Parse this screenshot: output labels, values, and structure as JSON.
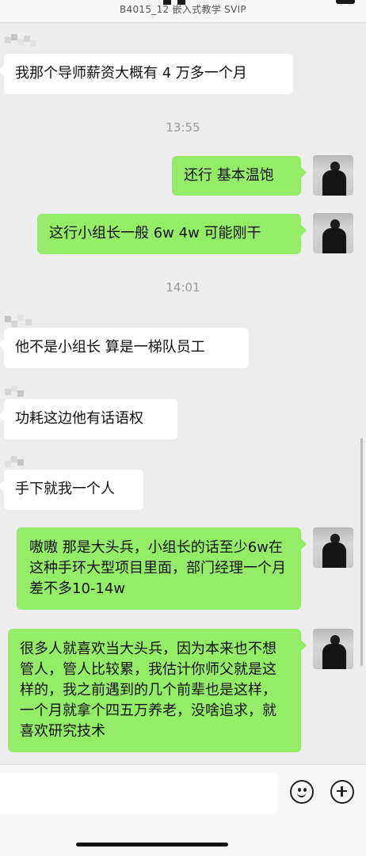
{
  "header": {
    "title": "B4015_12 嵌入式教学 SVIP"
  },
  "messages": [
    {
      "side": "in",
      "text": "我那个导师薪资大概有 4 万多一个月"
    },
    {
      "type": "time",
      "text": "13:55"
    },
    {
      "side": "out",
      "text": "还行 基本温饱"
    },
    {
      "side": "out",
      "text": "这行小组长一般 6w 4w 可能刚干"
    },
    {
      "type": "time",
      "text": "14:01"
    },
    {
      "side": "in",
      "text": "他不是小组长 算是一梯队员工"
    },
    {
      "side": "in",
      "text": "功耗这边他有话语权"
    },
    {
      "side": "in",
      "text": "手下就我一个人"
    },
    {
      "side": "out",
      "text": "嗷嗷 那是大头兵，小组长的话至少6w在这种手环大型项目里面，部门经理一个月差不多10-14w"
    },
    {
      "side": "out",
      "text": "很多人就喜欢当大头兵，因为本来也不想管人，管人比较累，我估计你师父就是这样的，我之前遇到的几个前辈也是这样，一个月就拿个四五万养老，没啥追求，就喜欢研究技术"
    }
  ],
  "input_bar": {
    "input_value": "",
    "emoji_button": "emoji-icon",
    "more_button": "plus-circle-icon"
  },
  "colors": {
    "outgoing_bubble": "#95ec69",
    "incoming_bubble": "#ffffff",
    "background": "#ededed"
  }
}
